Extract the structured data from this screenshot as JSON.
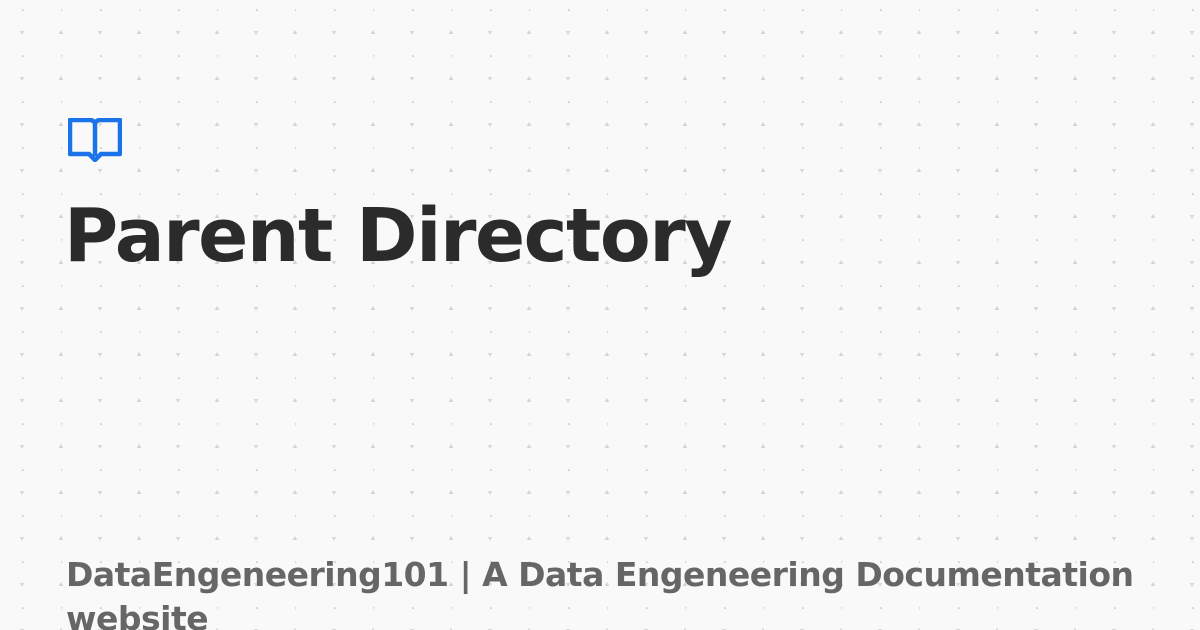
{
  "page": {
    "title": "Parent Directory",
    "site_name": "DataEngeneering101 | A Data Engeneering Documentation website"
  },
  "icons": {
    "logo": "open-book-icon"
  },
  "colors": {
    "background": "#f9f9f9",
    "pattern": "#d6d6d6",
    "title": "#2b2b2b",
    "site_name": "#666666",
    "accent": "#1a73e8"
  }
}
